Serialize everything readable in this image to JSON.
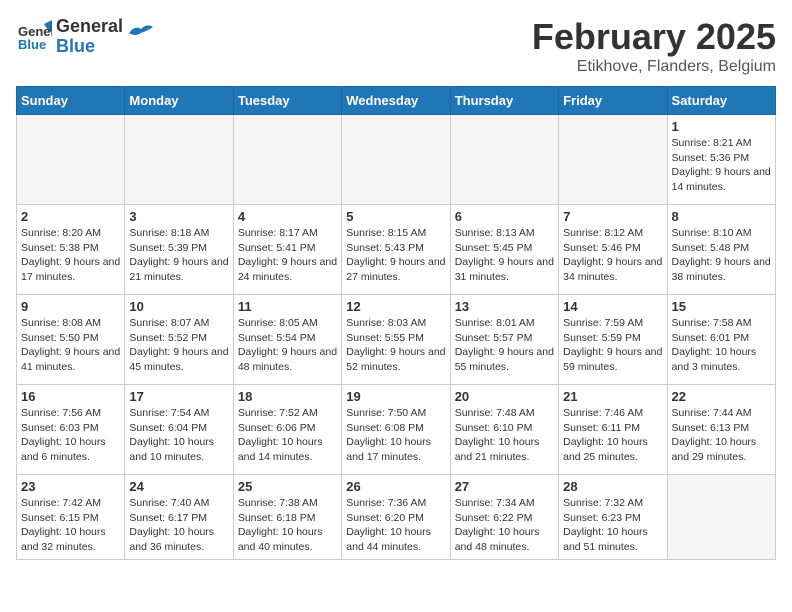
{
  "header": {
    "logo_line1": "General",
    "logo_line2": "Blue",
    "title": "February 2025",
    "subtitle": "Etikhove, Flanders, Belgium"
  },
  "days_of_week": [
    "Sunday",
    "Monday",
    "Tuesday",
    "Wednesday",
    "Thursday",
    "Friday",
    "Saturday"
  ],
  "weeks": [
    [
      {
        "day": "",
        "info": ""
      },
      {
        "day": "",
        "info": ""
      },
      {
        "day": "",
        "info": ""
      },
      {
        "day": "",
        "info": ""
      },
      {
        "day": "",
        "info": ""
      },
      {
        "day": "",
        "info": ""
      },
      {
        "day": "1",
        "info": "Sunrise: 8:21 AM\nSunset: 5:36 PM\nDaylight: 9 hours and 14 minutes."
      }
    ],
    [
      {
        "day": "2",
        "info": "Sunrise: 8:20 AM\nSunset: 5:38 PM\nDaylight: 9 hours and 17 minutes."
      },
      {
        "day": "3",
        "info": "Sunrise: 8:18 AM\nSunset: 5:39 PM\nDaylight: 9 hours and 21 minutes."
      },
      {
        "day": "4",
        "info": "Sunrise: 8:17 AM\nSunset: 5:41 PM\nDaylight: 9 hours and 24 minutes."
      },
      {
        "day": "5",
        "info": "Sunrise: 8:15 AM\nSunset: 5:43 PM\nDaylight: 9 hours and 27 minutes."
      },
      {
        "day": "6",
        "info": "Sunrise: 8:13 AM\nSunset: 5:45 PM\nDaylight: 9 hours and 31 minutes."
      },
      {
        "day": "7",
        "info": "Sunrise: 8:12 AM\nSunset: 5:46 PM\nDaylight: 9 hours and 34 minutes."
      },
      {
        "day": "8",
        "info": "Sunrise: 8:10 AM\nSunset: 5:48 PM\nDaylight: 9 hours and 38 minutes."
      }
    ],
    [
      {
        "day": "9",
        "info": "Sunrise: 8:08 AM\nSunset: 5:50 PM\nDaylight: 9 hours and 41 minutes."
      },
      {
        "day": "10",
        "info": "Sunrise: 8:07 AM\nSunset: 5:52 PM\nDaylight: 9 hours and 45 minutes."
      },
      {
        "day": "11",
        "info": "Sunrise: 8:05 AM\nSunset: 5:54 PM\nDaylight: 9 hours and 48 minutes."
      },
      {
        "day": "12",
        "info": "Sunrise: 8:03 AM\nSunset: 5:55 PM\nDaylight: 9 hours and 52 minutes."
      },
      {
        "day": "13",
        "info": "Sunrise: 8:01 AM\nSunset: 5:57 PM\nDaylight: 9 hours and 55 minutes."
      },
      {
        "day": "14",
        "info": "Sunrise: 7:59 AM\nSunset: 5:59 PM\nDaylight: 9 hours and 59 minutes."
      },
      {
        "day": "15",
        "info": "Sunrise: 7:58 AM\nSunset: 6:01 PM\nDaylight: 10 hours and 3 minutes."
      }
    ],
    [
      {
        "day": "16",
        "info": "Sunrise: 7:56 AM\nSunset: 6:03 PM\nDaylight: 10 hours and 6 minutes."
      },
      {
        "day": "17",
        "info": "Sunrise: 7:54 AM\nSunset: 6:04 PM\nDaylight: 10 hours and 10 minutes."
      },
      {
        "day": "18",
        "info": "Sunrise: 7:52 AM\nSunset: 6:06 PM\nDaylight: 10 hours and 14 minutes."
      },
      {
        "day": "19",
        "info": "Sunrise: 7:50 AM\nSunset: 6:08 PM\nDaylight: 10 hours and 17 minutes."
      },
      {
        "day": "20",
        "info": "Sunrise: 7:48 AM\nSunset: 6:10 PM\nDaylight: 10 hours and 21 minutes."
      },
      {
        "day": "21",
        "info": "Sunrise: 7:46 AM\nSunset: 6:11 PM\nDaylight: 10 hours and 25 minutes."
      },
      {
        "day": "22",
        "info": "Sunrise: 7:44 AM\nSunset: 6:13 PM\nDaylight: 10 hours and 29 minutes."
      }
    ],
    [
      {
        "day": "23",
        "info": "Sunrise: 7:42 AM\nSunset: 6:15 PM\nDaylight: 10 hours and 32 minutes."
      },
      {
        "day": "24",
        "info": "Sunrise: 7:40 AM\nSunset: 6:17 PM\nDaylight: 10 hours and 36 minutes."
      },
      {
        "day": "25",
        "info": "Sunrise: 7:38 AM\nSunset: 6:18 PM\nDaylight: 10 hours and 40 minutes."
      },
      {
        "day": "26",
        "info": "Sunrise: 7:36 AM\nSunset: 6:20 PM\nDaylight: 10 hours and 44 minutes."
      },
      {
        "day": "27",
        "info": "Sunrise: 7:34 AM\nSunset: 6:22 PM\nDaylight: 10 hours and 48 minutes."
      },
      {
        "day": "28",
        "info": "Sunrise: 7:32 AM\nSunset: 6:23 PM\nDaylight: 10 hours and 51 minutes."
      },
      {
        "day": "",
        "info": ""
      }
    ]
  ]
}
